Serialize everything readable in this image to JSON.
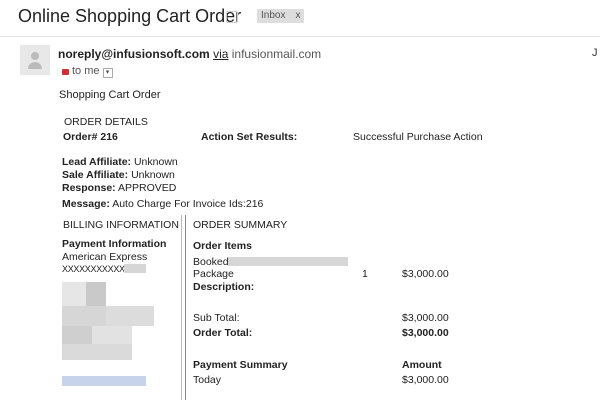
{
  "header": {
    "subject": "Online Shopping Cart Order",
    "label": "Inbox",
    "label_close": "x"
  },
  "sender": {
    "email": "noreply@infusionsoft.com",
    "via": "via",
    "via_host": "infusionmail.com",
    "to": "to me",
    "right_mark": "J"
  },
  "body": {
    "heading": "Shopping Cart Order",
    "order_details": "ORDER DETAILS",
    "order_no": "Order# 216",
    "action_set_label": "Action Set Results:",
    "action_set_value": "Successful Purchase Action",
    "lead_affiliate_label": "Lead Affiliate:",
    "lead_affiliate_value": "Unknown",
    "sale_affiliate_label": "Sale Affiliate:",
    "sale_affiliate_value": "Unknown",
    "response_label": "Response:",
    "response_value": "APPROVED",
    "message_label": "Message:",
    "message_value": "Auto Charge For Invoice Ids:216"
  },
  "billing": {
    "title": "BILLING INFORMATION",
    "payment_info": "Payment Information",
    "card_type": "American Express",
    "card_number": "XXXXXXXXXXXX"
  },
  "summary": {
    "title": "ORDER SUMMARY",
    "order_items": "Order Items",
    "item_line1": "Booked",
    "item_line2": "Package",
    "item_qty": "1",
    "item_price": "$3,000.00",
    "description": "Description:",
    "subtotal_label": "Sub Total:",
    "subtotal_value": "$3,000.00",
    "order_total_label": "Order Total:",
    "order_total_value": "$3,000.00",
    "payment_summary": "Payment Summary",
    "amount": "Amount",
    "today": "Today",
    "today_value": "$3,000.00"
  },
  "colors": {
    "label_bg": "#dddddd",
    "lock": "#cc3333"
  }
}
